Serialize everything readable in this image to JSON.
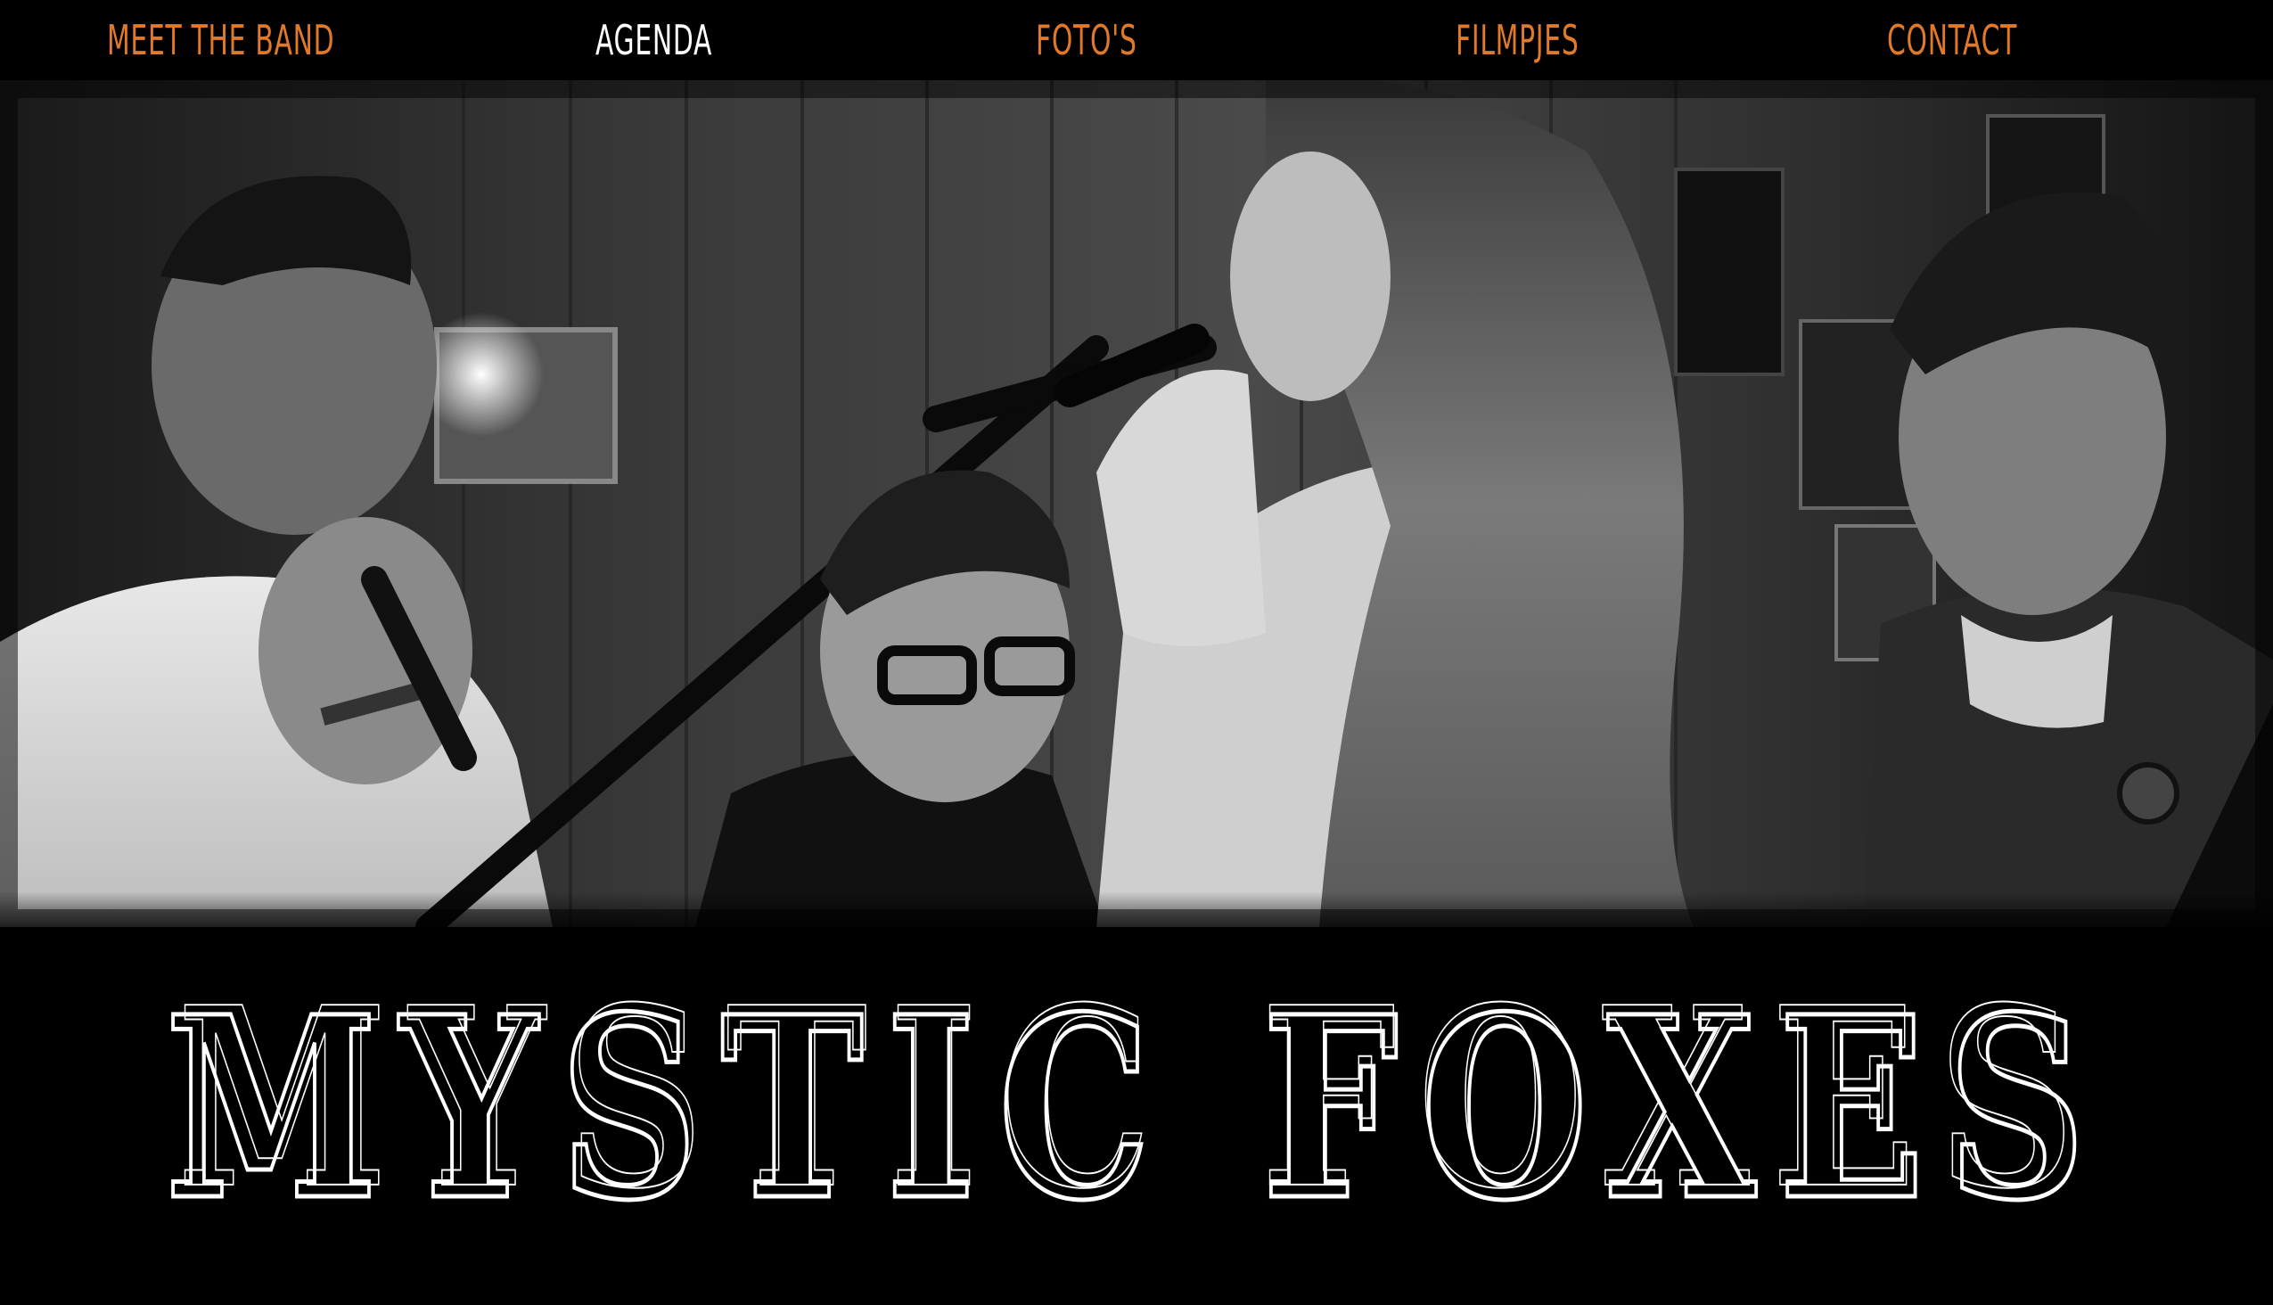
{
  "nav": {
    "items": [
      {
        "label": "MEET THE BAND",
        "active": false
      },
      {
        "label": "AGENDA",
        "active": true
      },
      {
        "label": "FOTO'S",
        "active": false
      },
      {
        "label": "FILMPJES",
        "active": false
      },
      {
        "label": "CONTACT",
        "active": false
      }
    ]
  },
  "hero": {
    "title": "MYSTIC FOXES"
  },
  "colors": {
    "accent": "#e07a2a",
    "active": "#ffffff",
    "background": "#000000"
  }
}
